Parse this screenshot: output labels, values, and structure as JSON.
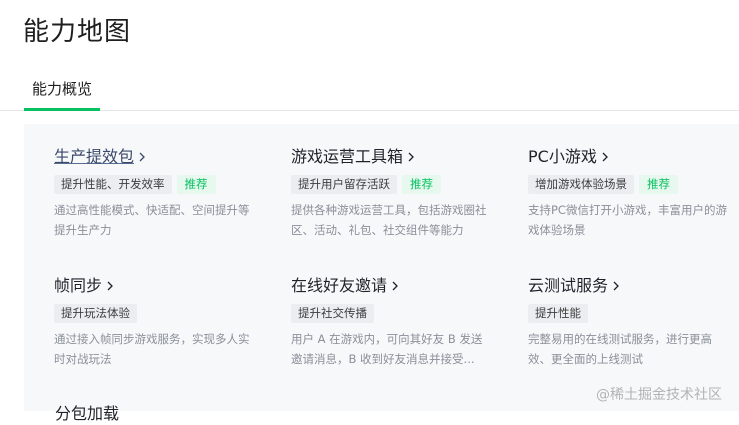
{
  "page": {
    "title": "能力地图"
  },
  "tabs": [
    {
      "label": "能力概览",
      "active": true
    }
  ],
  "colors": {
    "accent": "#07c160",
    "badge_bg": "#e7f8ee",
    "tag_bg": "#ebedf0",
    "panel_bg": "#f7f8fa"
  },
  "cards": [
    {
      "title": "生产提效包",
      "tag": "提升性能、开发效率",
      "badge": "推荐",
      "desc": "通过高性能模式、快适配、空间提升等提升生产力",
      "icon": "chevron-right-icon"
    },
    {
      "title": "游戏运营工具箱",
      "tag": "提升用户留存活跃",
      "badge": "推荐",
      "desc": "提供各种游戏运营工具，包括游戏圈社区、活动、礼包、社交组件等能力",
      "icon": "chevron-right-icon"
    },
    {
      "title": "PC小游戏",
      "tag": "增加游戏体验场景",
      "badge": "推荐",
      "desc": "支持PC微信打开小游戏，丰富用户的游戏体验场景",
      "icon": "chevron-right-icon"
    },
    {
      "title": "帧同步",
      "tag": "提升玩法体验",
      "desc": "通过接入帧同步游戏服务，实现多人实时对战玩法",
      "icon": "chevron-right-icon"
    },
    {
      "title": "在线好友邀请",
      "tag": "提升社交传播",
      "desc": "用户 A 在游戏内，可向其好友 B 发送邀请消息，B 收到好友消息并接受...",
      "icon": "chevron-right-icon"
    },
    {
      "title": "云测试服务",
      "tag": "提升性能",
      "desc": "完整易用的在线测试服务，进行更高效、更全面的上线测试",
      "icon": "chevron-right-icon"
    }
  ],
  "partial_next": "分包加载",
  "watermark": "@稀土掘金技术社区"
}
